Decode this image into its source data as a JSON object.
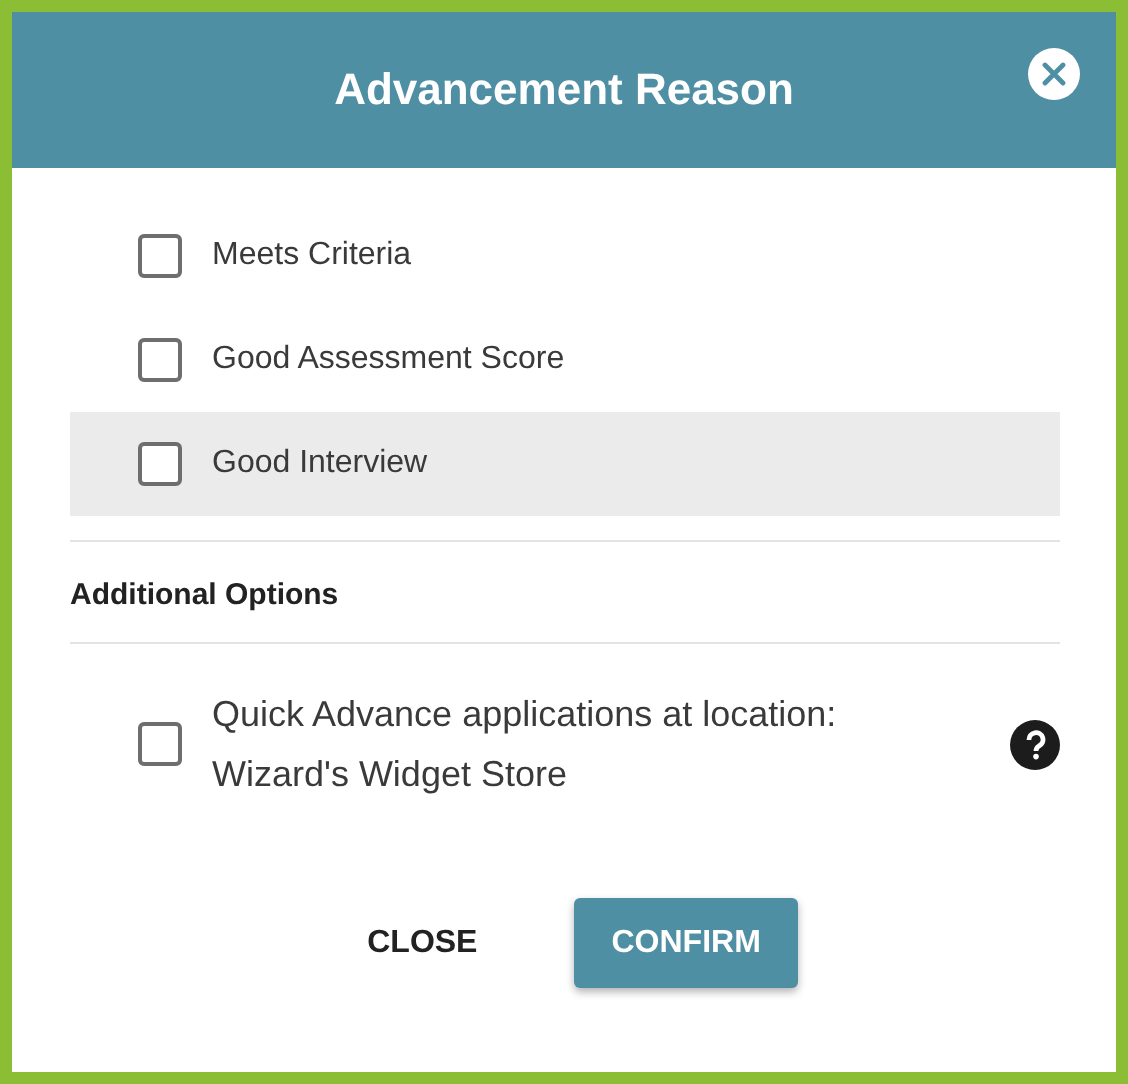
{
  "dialog": {
    "title": "Advancement Reason"
  },
  "reasons": [
    {
      "label": "Meets Criteria",
      "checked": false,
      "highlighted": false
    },
    {
      "label": "Good Assessment Score",
      "checked": false,
      "highlighted": false
    },
    {
      "label": "Good Interview",
      "checked": false,
      "highlighted": true
    }
  ],
  "additional_options": {
    "heading": "Additional Options",
    "options": [
      {
        "label": "Quick Advance applications at location: Wizard's Widget Store",
        "checked": false
      }
    ]
  },
  "buttons": [
    {
      "label": "CLOSE",
      "kind": "text"
    },
    {
      "label": "CONFIRM",
      "kind": "primary"
    }
  ]
}
